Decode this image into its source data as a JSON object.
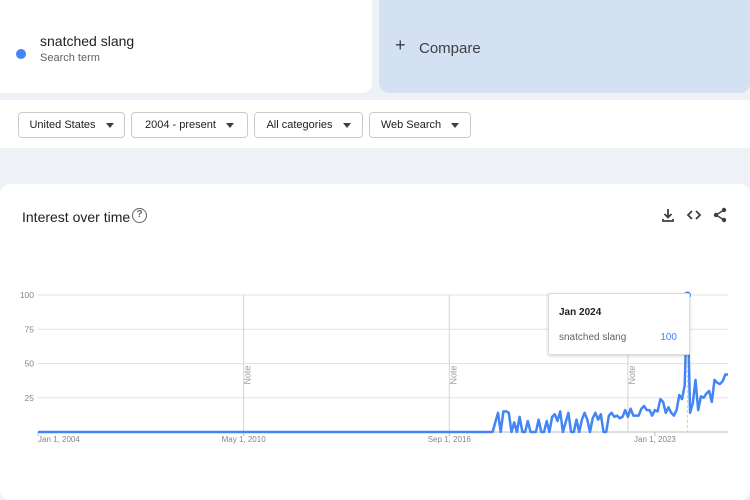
{
  "search_term": {
    "name": "snatched slang",
    "subtitle": "Search term",
    "color": "#4285f4"
  },
  "compare": {
    "label": "Compare",
    "icon": "plus-icon"
  },
  "filters": [
    {
      "label": "United States"
    },
    {
      "label": "2004 - present"
    },
    {
      "label": "All categories"
    },
    {
      "label": "Web Search"
    }
  ],
  "chart": {
    "title": "Interest over time",
    "tools": [
      "download-icon",
      "embed-icon",
      "share-icon"
    ],
    "tooltip": {
      "date": "Jan 2024",
      "term": "snatched slang",
      "value": "100"
    }
  },
  "chart_data": {
    "type": "line",
    "title": "",
    "xlabel": "",
    "ylabel": "",
    "ylim": [
      0,
      100
    ],
    "yticks": [
      25,
      50,
      75,
      100
    ],
    "xtick_labels": [
      "Jan 1, 2004",
      "May 1, 2010",
      "Sep 1, 2016",
      "Jan 1, 2023"
    ],
    "xtick_dates": [
      "2004-01",
      "2010-05",
      "2016-09",
      "2023-01"
    ],
    "xlim": [
      "2004-01",
      "2025-04"
    ],
    "notes": [
      {
        "date": "2010-05",
        "label": "Note"
      },
      {
        "date": "2016-09",
        "label": "Note"
      },
      {
        "date": "2022-03",
        "label": "Note"
      }
    ],
    "grid": true,
    "series": [
      {
        "name": "snatched slang",
        "color": "#4285f4",
        "x": [
          "2004-01",
          "2018-01",
          "2018-03",
          "2018-04",
          "2018-05",
          "2018-06",
          "2018-07",
          "2018-08",
          "2018-09",
          "2018-10",
          "2018-11",
          "2018-12",
          "2019-01",
          "2019-02",
          "2019-03",
          "2019-04",
          "2019-05",
          "2019-06",
          "2019-07",
          "2019-08",
          "2019-09",
          "2019-10",
          "2019-11",
          "2019-12",
          "2020-01",
          "2020-02",
          "2020-03",
          "2020-04",
          "2020-05",
          "2020-06",
          "2020-07",
          "2020-08",
          "2020-09",
          "2020-10",
          "2020-11",
          "2020-12",
          "2021-01",
          "2021-02",
          "2021-03",
          "2021-04",
          "2021-05",
          "2021-06",
          "2021-07",
          "2021-08",
          "2021-09",
          "2021-10",
          "2021-11",
          "2021-12",
          "2022-01",
          "2022-02",
          "2022-03",
          "2022-04",
          "2022-05",
          "2022-06",
          "2022-07",
          "2022-08",
          "2022-09",
          "2022-10",
          "2022-11",
          "2022-12",
          "2023-01",
          "2023-02",
          "2023-03",
          "2023-04",
          "2023-05",
          "2023-06",
          "2023-07",
          "2023-08",
          "2023-09",
          "2023-10",
          "2023-11",
          "2023-12",
          "2024-01",
          "2024-02",
          "2024-03",
          "2024-04",
          "2024-05",
          "2024-06",
          "2024-07",
          "2024-08",
          "2024-09",
          "2024-10",
          "2024-11",
          "2024-12",
          "2025-01",
          "2025-02",
          "2025-03",
          "2025-04"
        ],
        "values": [
          0,
          0,
          14,
          0,
          15,
          15,
          14,
          0,
          7,
          0,
          11,
          0,
          0,
          8,
          0,
          0,
          0,
          9,
          0,
          0,
          8,
          0,
          11,
          13,
          8,
          15,
          0,
          7,
          14,
          0,
          0,
          9,
          0,
          9,
          14,
          9,
          0,
          10,
          14,
          9,
          13,
          0,
          0,
          12,
          14,
          11,
          12,
          10,
          11,
          16,
          11,
          17,
          12,
          12,
          12,
          17,
          19,
          16,
          16,
          12,
          16,
          15,
          24,
          22,
          14,
          18,
          14,
          12,
          16,
          27,
          24,
          34,
          100,
          14,
          21,
          38,
          16,
          26,
          25,
          28,
          30,
          22,
          38,
          36,
          35,
          37,
          42,
          42
        ]
      }
    ]
  }
}
